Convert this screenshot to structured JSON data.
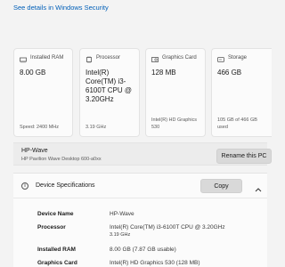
{
  "security_link": "See details in Windows Security",
  "cards": [
    {
      "title": "Installed RAM",
      "icon": "ram-icon",
      "value": "8.00 GB",
      "sub": "Speed: 2400 MHz"
    },
    {
      "title": "Processor",
      "icon": "processor-icon",
      "value": "Intel(R) Core(TM) i3-6100T CPU @ 3.20GHz",
      "sub": "3.19 GHz"
    },
    {
      "title": "Graphics Card",
      "icon": "graphics-card-icon",
      "value": "128 MB",
      "sub": "Intel(R) HD Graphics 530"
    },
    {
      "title": "Storage",
      "icon": "storage-icon",
      "value": "466 GB",
      "sub": "105 GB of 466 GB used"
    }
  ],
  "device": {
    "name": "HP-Wave",
    "model": "HP Pavilion Wave Desktop 600-a0xx",
    "rename_label": "Rename this PC"
  },
  "specs": {
    "title": "Device Specifications",
    "copy_label": "Copy",
    "rows": [
      {
        "key": "Device Name",
        "value": "HP-Wave",
        "value2": ""
      },
      {
        "key": "Processor",
        "value": "Intel(R)  Core(TM)  i3-6100T  CPU  @  3.20GHz",
        "value2": "3.19 GHz"
      },
      {
        "key": "Installed RAM",
        "value": "8.00 GB (7.87 GB usable)",
        "value2": ""
      },
      {
        "key": "Graphics Card",
        "value": "Intel(R) HD Graphics 530 (128 MB)",
        "value2": ""
      }
    ]
  },
  "colors": {
    "accent_link": "#005fb8",
    "button": "#d9d9d9"
  }
}
